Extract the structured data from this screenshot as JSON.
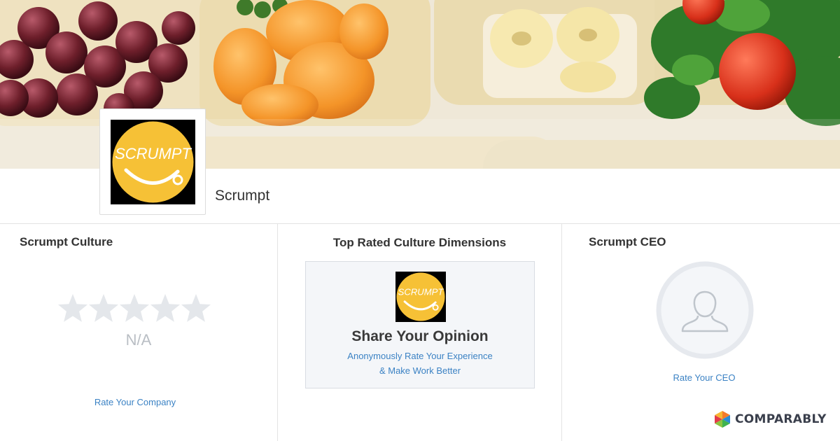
{
  "company": {
    "name": "Scrumpt",
    "logo_text": "SCRUMPT"
  },
  "culture": {
    "title": "Scrumpt Culture",
    "rating": "N/A",
    "stars_filled": 0,
    "stars_total": 5,
    "rate_link": "Rate Your Company"
  },
  "dimensions": {
    "title": "Top Rated Culture Dimensions",
    "cta_title": "Share Your Opinion",
    "cta_line1": "Anonymously Rate Your Experience",
    "cta_line2": "& Make Work Better"
  },
  "ceo": {
    "title": "Scrumpt CEO",
    "rate_link": "Rate Your CEO"
  },
  "brand": {
    "name": "COMPARABLY"
  },
  "colors": {
    "logo_yellow": "#f6c136",
    "link_blue": "#3b82c4",
    "star_gray": "#e4e7eb"
  }
}
